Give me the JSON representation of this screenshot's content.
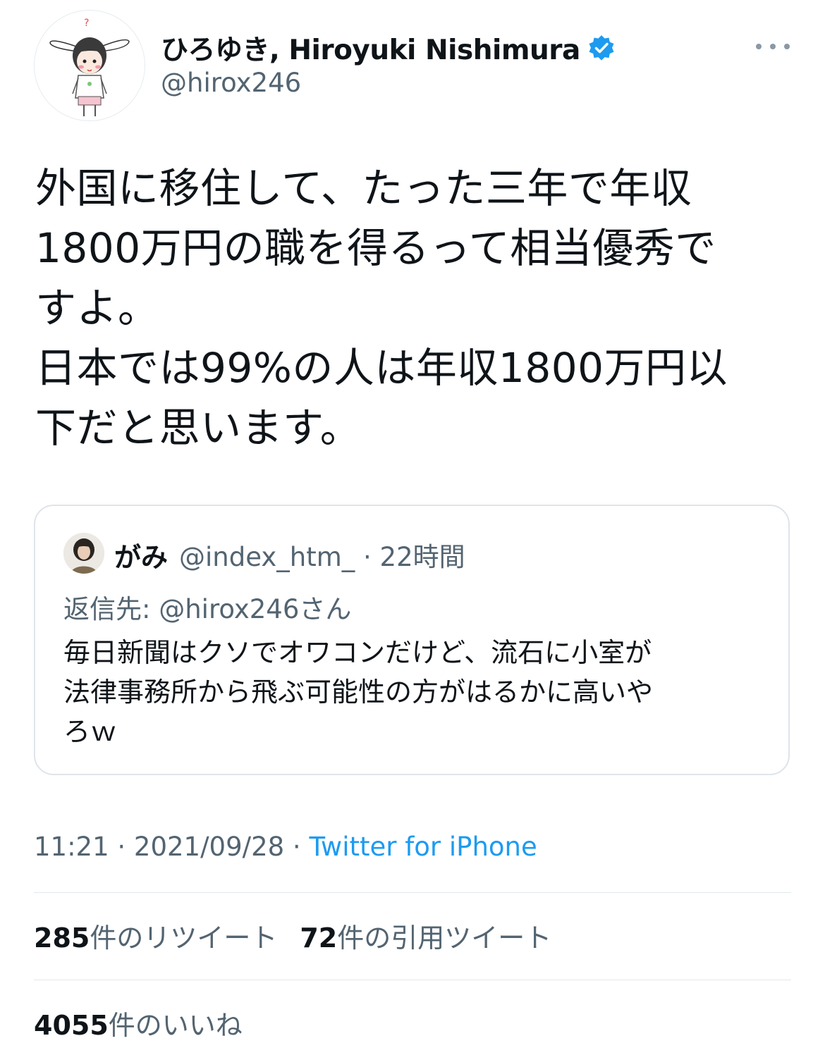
{
  "author": {
    "display_name": "ひろゆき, Hiroyuki Nishimura",
    "handle": "@hirox246",
    "verified": true
  },
  "tweet": {
    "text": "外国に移住して、たった三年で年収\n1800万円の職を得るって相当優秀で\nすよ。\n日本では99%の人は年収1800万円以\n下だと思います。"
  },
  "quoted_tweet": {
    "display_name": "がみ",
    "meta": "@index_htm_ · 22時間",
    "reply_to": "返信先: @hirox246さん",
    "text": "毎日新聞はクソでオワコンだけど、流石に小室が\n法律事務所から飛ぶ可能性の方がはるかに高いや\nろｗ"
  },
  "meta": {
    "time_date": "11:21 · 2021/09/28 · ",
    "source": "Twitter for iPhone"
  },
  "stats": {
    "retweets_count": "285",
    "retweets_label": "件のリツイート",
    "quotes_count": "72",
    "quotes_label": "件の引用ツイート",
    "likes_count": "4055",
    "likes_label": "件のいいね"
  },
  "colors": {
    "text": "#0f1419",
    "secondary": "#536471",
    "accent": "#1d9bf0",
    "border": "#dfe4ea"
  },
  "icons": {
    "verified": "verified-badge-icon",
    "more": "more-horizontal-icon"
  }
}
